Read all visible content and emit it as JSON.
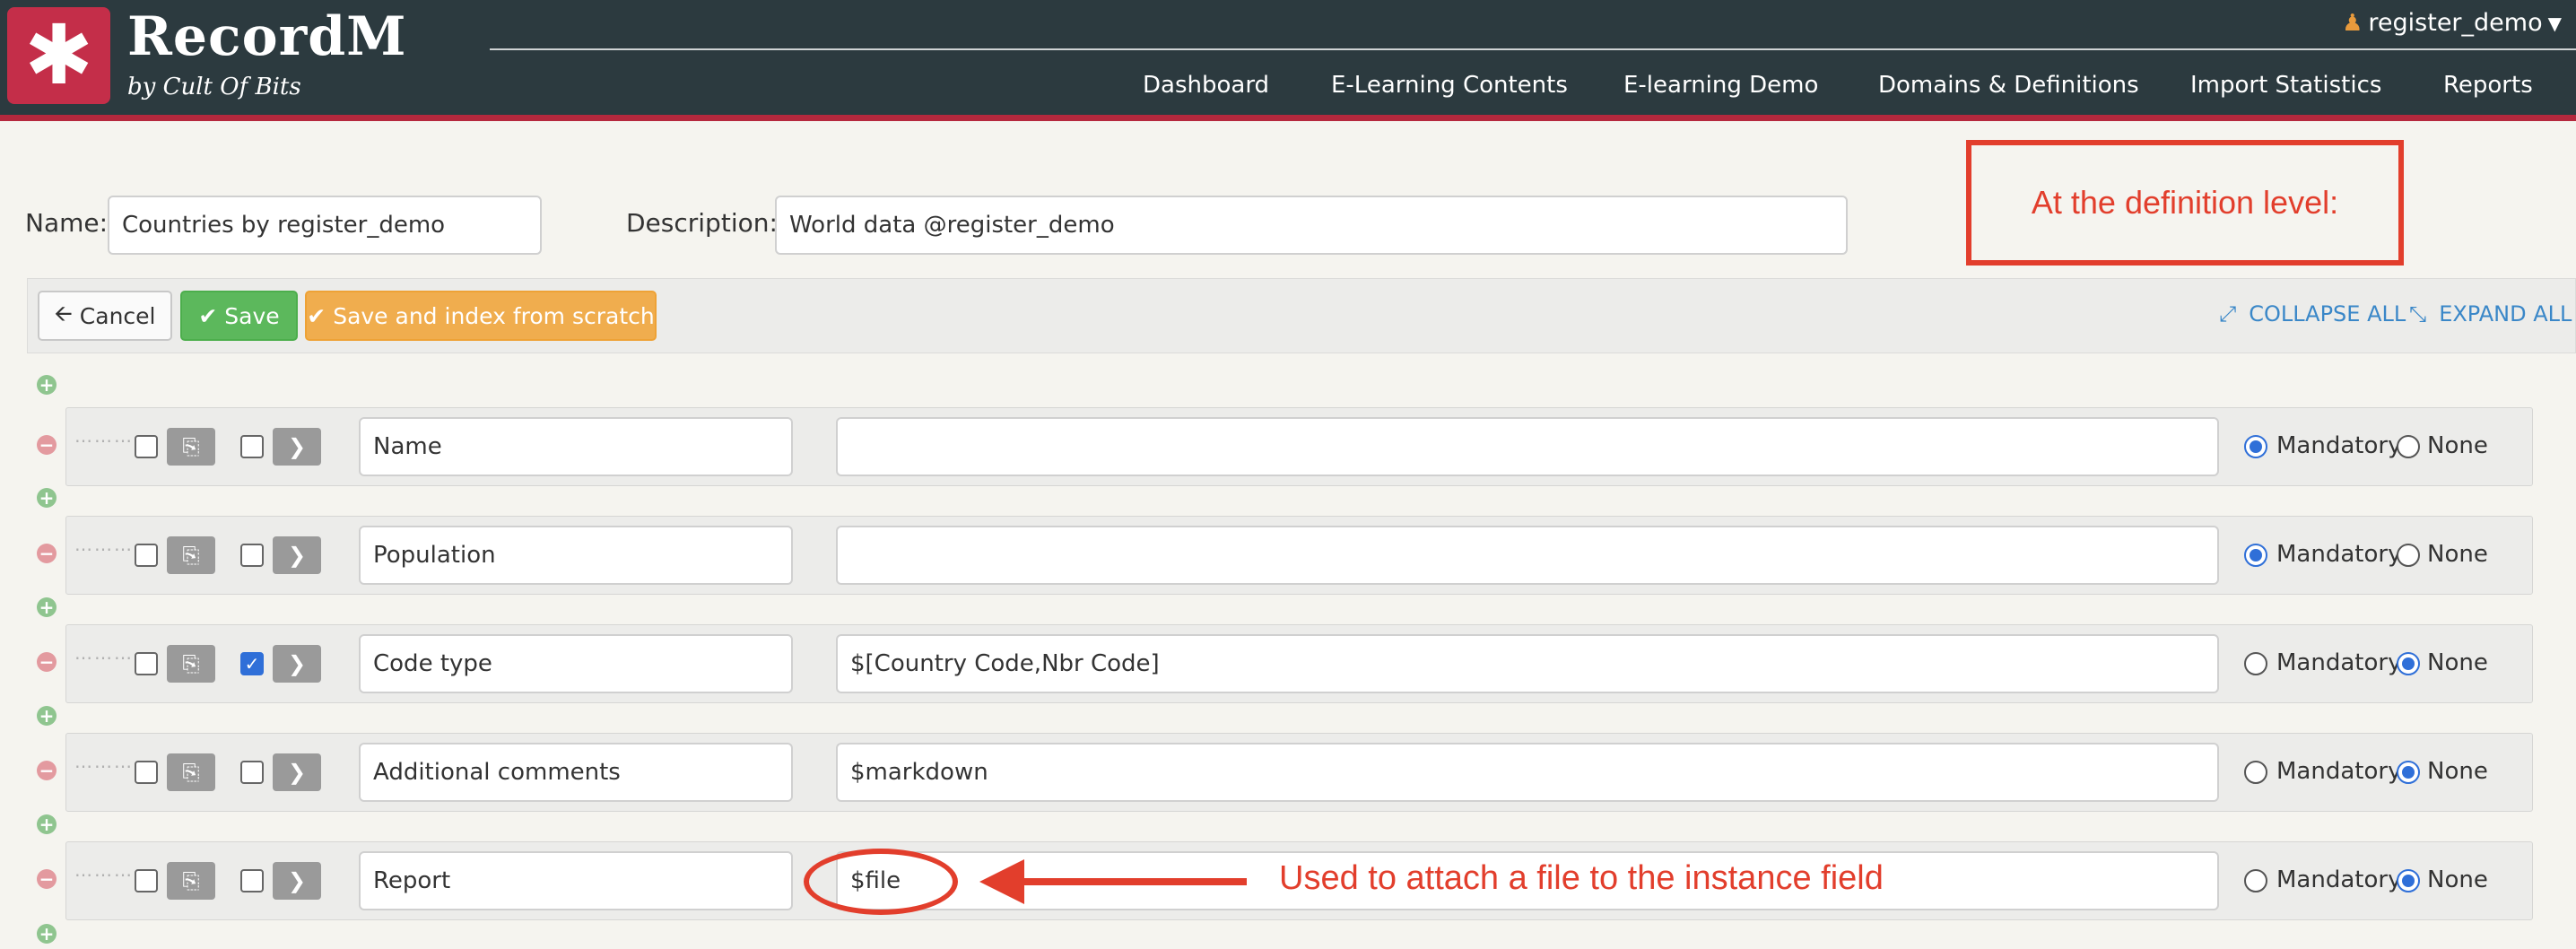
{
  "app": {
    "title": "RecordM",
    "subtitle": "by Cult Of Bits",
    "logo_glyph": "✱"
  },
  "user": {
    "name": "register_demo"
  },
  "nav": [
    {
      "label": "Dashboard"
    },
    {
      "label": "E-Learning Contents"
    },
    {
      "label": "E-learning Demo"
    },
    {
      "label": "Domains & Definitions"
    },
    {
      "label": "Import Statistics"
    },
    {
      "label": "Reports"
    }
  ],
  "form": {
    "name_label": "Name:",
    "name_value": "Countries by register_demo",
    "description_label": "Description:",
    "description_value": "World data @register_demo"
  },
  "toolbar": {
    "cancel": "Cancel",
    "save": "Save",
    "save_index": "Save and index from scratch",
    "collapse_all": "COLLAPSE ALL",
    "expand_all": "EXPAND ALL"
  },
  "radio_labels": {
    "mandatory": "Mandatory",
    "none": "None"
  },
  "fields": [
    {
      "name": "Name",
      "type": "",
      "checkbox1": false,
      "checkbox2": false,
      "required": "mandatory"
    },
    {
      "name": "Population",
      "type": "",
      "checkbox1": false,
      "checkbox2": false,
      "required": "mandatory"
    },
    {
      "name": "Code type",
      "type": "$[Country Code,Nbr Code]",
      "checkbox1": false,
      "checkbox2": true,
      "required": "none"
    },
    {
      "name": "Additional comments",
      "type": "$markdown",
      "checkbox1": false,
      "checkbox2": false,
      "required": "none"
    },
    {
      "name": "Report",
      "type": "$file",
      "checkbox1": false,
      "checkbox2": false,
      "required": "none"
    }
  ],
  "annotations": {
    "definition_level": "At the definition level:",
    "file_note": "Used to attach a file to the instance field"
  },
  "colors": {
    "header": "#2c3a3f",
    "accent": "#c42e49",
    "annotation": "#e23e2c",
    "save": "#5cb85c",
    "index": "#f0ad4e",
    "link": "#3a87c8"
  }
}
